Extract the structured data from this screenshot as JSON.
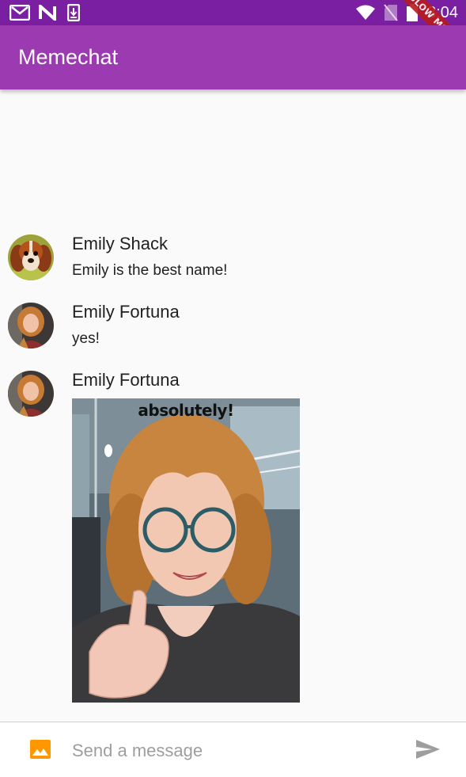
{
  "status_bar": {
    "time": "3:04",
    "icons": [
      "gmail-icon",
      "n-app-icon",
      "download-icon",
      "wifi-icon",
      "no-sim-icon",
      "battery-icon"
    ]
  },
  "debug_banner": {
    "label": "SLOW MODE"
  },
  "app_bar": {
    "title": "Memechat"
  },
  "messages": [
    {
      "sender": "Emily Shack",
      "text": "Emily is the best name!",
      "avatar": "dog-avatar"
    },
    {
      "sender": "Emily Fortuna",
      "text": "yes!",
      "avatar": "person-avatar"
    },
    {
      "sender": "Emily Fortuna",
      "image": "thumbs-up-selfie-photo",
      "image_caption": "absolutely!",
      "avatar": "person-avatar"
    }
  ],
  "composer": {
    "placeholder": "Send a message",
    "value": ""
  },
  "colors": {
    "status_bar": "#7b1fa2",
    "app_bar": "#9c3ab2",
    "image_icon": "#ff9800",
    "send_icon": "#9e9e9e"
  }
}
